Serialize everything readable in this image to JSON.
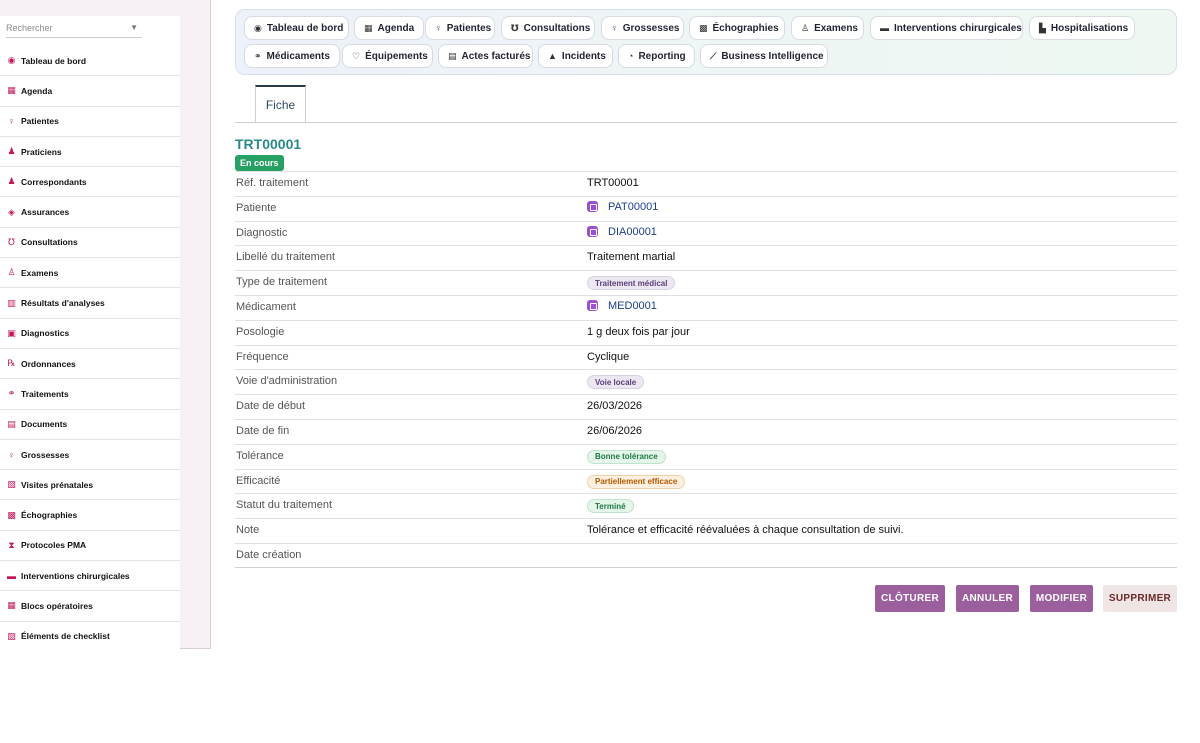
{
  "sidebar": {
    "search_placeholder": "Rechercher",
    "items": [
      {
        "label": "Tableau de bord",
        "icon": "dashboard-icon",
        "glyph": "◉"
      },
      {
        "label": "Agenda",
        "icon": "calendar-icon",
        "glyph": "▦"
      },
      {
        "label": "Patientes",
        "icon": "female-icon",
        "glyph": "♀"
      },
      {
        "label": "Praticiens",
        "icon": "doctor-icon",
        "glyph": "♟"
      },
      {
        "label": "Correspondants",
        "icon": "user-icon",
        "glyph": "♟"
      },
      {
        "label": "Assurances",
        "icon": "shield-icon",
        "glyph": "◈"
      },
      {
        "label": "Consultations",
        "icon": "stethoscope-icon",
        "glyph": "℧"
      },
      {
        "label": "Examens",
        "icon": "exam-icon",
        "glyph": "♙"
      },
      {
        "label": "Résultats d'analyses",
        "icon": "lab-results-icon",
        "glyph": "▥"
      },
      {
        "label": "Diagnostics",
        "icon": "diagnostic-icon",
        "glyph": "▣"
      },
      {
        "label": "Ordonnances",
        "icon": "prescription-icon",
        "glyph": "℞"
      },
      {
        "label": "Traitements",
        "icon": "pills-icon",
        "glyph": "⚭"
      },
      {
        "label": "Documents",
        "icon": "document-icon",
        "glyph": "▤"
      },
      {
        "label": "Grossesses",
        "icon": "pregnancy-icon",
        "glyph": "♀"
      },
      {
        "label": "Visites prénatales",
        "icon": "clipboard-icon",
        "glyph": "▧"
      },
      {
        "label": "Échographies",
        "icon": "ultrasound-icon",
        "glyph": "▩"
      },
      {
        "label": "Protocoles PMA",
        "icon": "protocol-icon",
        "glyph": "⧗"
      },
      {
        "label": "Interventions chirurgicales",
        "icon": "bed-icon",
        "glyph": "▬"
      },
      {
        "label": "Blocs opératoires",
        "icon": "operating-room-icon",
        "glyph": "▦"
      },
      {
        "label": "Éléments de checklist",
        "icon": "checklist-icon",
        "glyph": "▨"
      }
    ]
  },
  "topbar": {
    "buttons": [
      {
        "label": "Tableau de bord",
        "icon": "dashboard-icon",
        "glyph": "◉"
      },
      {
        "label": "Agenda",
        "icon": "calendar-icon",
        "glyph": "▦"
      },
      {
        "label": "Patientes",
        "icon": "female-icon",
        "glyph": "♀"
      },
      {
        "label": "Consultations",
        "icon": "stethoscope-icon",
        "glyph": "℧"
      },
      {
        "label": "Grossesses",
        "icon": "pregnancy-icon",
        "glyph": "♀"
      },
      {
        "label": "Échographies",
        "icon": "ultrasound-icon",
        "glyph": "▩"
      },
      {
        "label": "Examens",
        "icon": "exam-icon",
        "glyph": "♙"
      },
      {
        "label": "Interventions chirurgicales",
        "icon": "bed-icon",
        "glyph": "▬"
      },
      {
        "label": "Hospitalisations",
        "icon": "hospital-icon",
        "glyph": "▙"
      },
      {
        "label": "Médicaments",
        "icon": "pills-icon",
        "glyph": "⚭"
      },
      {
        "label": "Équipements",
        "icon": "equipment-icon",
        "glyph": "♡"
      },
      {
        "label": "Actes facturés",
        "icon": "invoice-icon",
        "glyph": "▤"
      },
      {
        "label": "Incidents",
        "icon": "warning-icon",
        "glyph": "▲"
      },
      {
        "label": "Reporting",
        "icon": "pie-chart-icon",
        "glyph": "◔"
      },
      {
        "label": "Business Intelligence",
        "icon": "line-chart-icon",
        "glyph": "⟋"
      }
    ]
  },
  "tabs": [
    {
      "label": "Fiche"
    }
  ],
  "record": {
    "title": "TRT00001",
    "status": "En cours",
    "fields": [
      {
        "label": "Réf. traitement",
        "value": "TRT00001",
        "kind": "text"
      },
      {
        "label": "Patiente",
        "value": "PAT00001",
        "kind": "link"
      },
      {
        "label": "Diagnostic",
        "value": "DIA00001",
        "kind": "link"
      },
      {
        "label": "Libellé du traitement",
        "value": "Traitement martial",
        "kind": "text"
      },
      {
        "label": "Type de traitement",
        "value": "Traitement médical",
        "kind": "chip",
        "bg": "#ece8f2",
        "fg": "#5b3f7a",
        "border": "#d9d0e6"
      },
      {
        "label": "Médicament",
        "value": "MED0001",
        "kind": "link"
      },
      {
        "label": "Posologie",
        "value": "1 g deux fois par jour",
        "kind": "text"
      },
      {
        "label": "Fréquence",
        "value": "Cyclique",
        "kind": "text"
      },
      {
        "label": "Voie d'administration",
        "value": "Voie locale",
        "kind": "chip",
        "bg": "#ece8f2",
        "fg": "#5b3f7a",
        "border": "#d9d0e6"
      },
      {
        "label": "Date de début",
        "value": "26/03/2026",
        "kind": "text"
      },
      {
        "label": "Date de fin",
        "value": "26/06/2026",
        "kind": "text"
      },
      {
        "label": "Tolérance",
        "value": "Bonne tolérance",
        "kind": "chip",
        "bg": "#e4f5ea",
        "fg": "#1f7a43",
        "border": "#bfe3cc"
      },
      {
        "label": "Efficacité",
        "value": "Partiellement efficace",
        "kind": "chip",
        "bg": "#fdf0e1",
        "fg": "#b25a00",
        "border": "#f3cfa5"
      },
      {
        "label": "Statut du traitement",
        "value": "Terminé",
        "kind": "chip",
        "bg": "#e4f5ea",
        "fg": "#1f7a43",
        "border": "#bfe3cc"
      },
      {
        "label": "Note",
        "value": "Tolérance et efficacité réévaluées à chaque consultation de suivi.",
        "kind": "text"
      },
      {
        "label": "Date création",
        "value": "",
        "kind": "text"
      }
    ]
  },
  "actions": [
    {
      "label": "CLÔTURER",
      "name": "cloturer-button",
      "bg": "#9b5f9d",
      "fg": "#ffffff"
    },
    {
      "label": "ANNULER",
      "name": "annuler-button",
      "bg": "#9b5f9d",
      "fg": "#ffffff"
    },
    {
      "label": "MODIFIER",
      "name": "modifier-button",
      "bg": "#9b5f9d",
      "fg": "#ffffff"
    },
    {
      "label": "SUPPRIMER",
      "name": "supprimer-button",
      "bg": "#efe5e5",
      "fg": "#6b2a2a"
    }
  ],
  "colors": {
    "accent": "#9b5f9d",
    "title": "#2a8a8a",
    "success": "#27a163"
  }
}
